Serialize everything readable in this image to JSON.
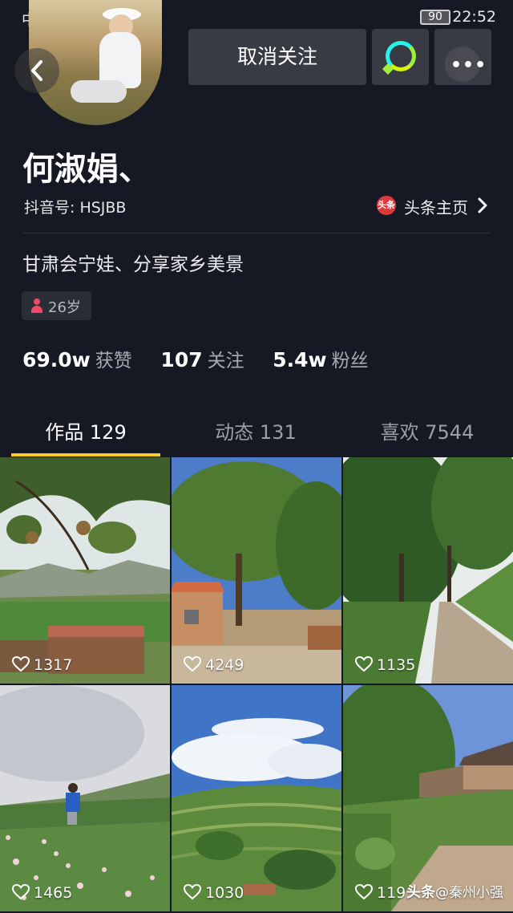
{
  "status_bar": {
    "carrier": "中国",
    "battery": "90",
    "time": "22:52"
  },
  "header": {
    "unfollow_label": "取消关注"
  },
  "profile": {
    "name": "何淑娟、",
    "douyin_id": "抖音号: HSJBB",
    "toutiao_logo_text": "头条",
    "toutiao_link": "头条主页",
    "bio": "甘肃会宁娃、分享家乡美景",
    "age": "26岁"
  },
  "stats": [
    {
      "value": "69.0w",
      "label": "获赞"
    },
    {
      "value": "107",
      "label": "关注"
    },
    {
      "value": "5.4w",
      "label": "粉丝"
    }
  ],
  "tabs": [
    {
      "label": "作品 129"
    },
    {
      "label": "动态 131"
    },
    {
      "label": "喜欢 7544"
    }
  ],
  "videos": [
    {
      "likes": "1317"
    },
    {
      "likes": "4249"
    },
    {
      "likes": "1135"
    },
    {
      "likes": "1465"
    },
    {
      "likes": "1030"
    },
    {
      "likes": "119"
    }
  ],
  "watermark": {
    "brand": "头条",
    "handle": "@秦州小强"
  },
  "colors": {
    "background": "#161823",
    "accent_underline": "#facb25",
    "button": "#393b44"
  }
}
